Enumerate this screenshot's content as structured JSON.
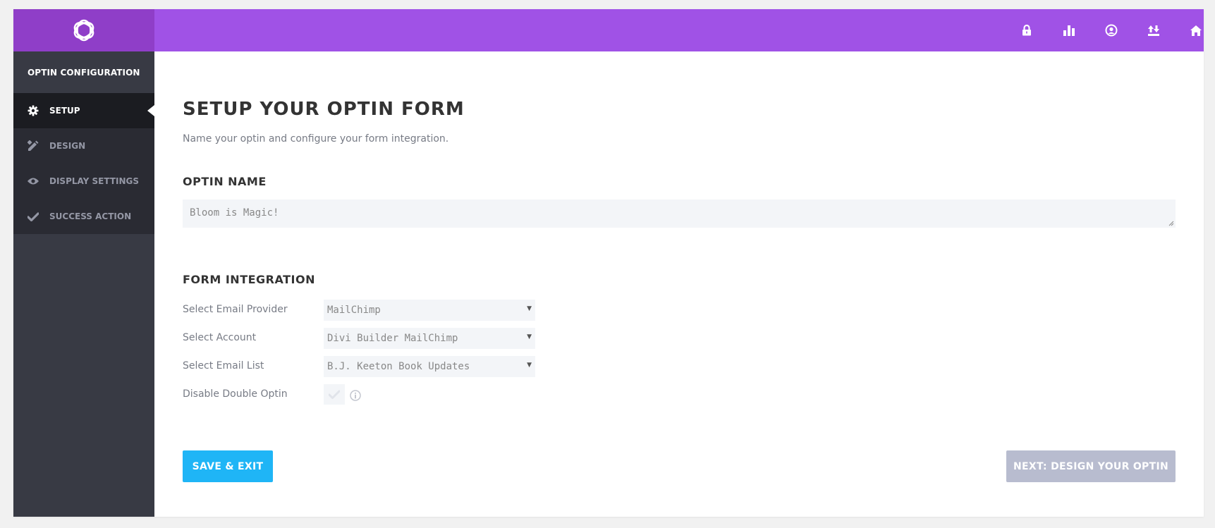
{
  "sidebar": {
    "header": "OPTIN CONFIGURATION",
    "items": [
      {
        "label": "SETUP",
        "icon": "gear-icon",
        "active": true
      },
      {
        "label": "DESIGN",
        "icon": "pencil-ruler-icon",
        "active": false
      },
      {
        "label": "DISPLAY SETTINGS",
        "icon": "eye-icon",
        "active": false
      },
      {
        "label": "SUCCESS ACTION",
        "icon": "checkmark-icon",
        "active": false
      }
    ]
  },
  "topbar": {
    "icons": [
      "lock-icon",
      "bar-chart-icon",
      "user-circle-icon",
      "import-export-icon",
      "home-icon"
    ]
  },
  "main": {
    "title": "SETUP YOUR OPTIN FORM",
    "subtitle": "Name your optin and configure your form integration.",
    "optin_name": {
      "heading": "OPTIN NAME",
      "value": "Bloom is Magic!"
    },
    "form_integration": {
      "heading": "FORM INTEGRATION",
      "email_provider": {
        "label": "Select Email Provider",
        "value": "MailChimp"
      },
      "account": {
        "label": "Select Account",
        "value": "Divi Builder MailChimp"
      },
      "email_list": {
        "label": "Select Email List",
        "value": "B.J. Keeton Book Updates"
      },
      "double_optin": {
        "label": "Disable Double Optin",
        "checked": false
      }
    },
    "buttons": {
      "save": "SAVE & EXIT",
      "next": "NEXT: DESIGN YOUR OPTIN"
    }
  },
  "colors": {
    "topbar": "#a052e6",
    "logo_bg": "#8f3ec8",
    "sidebar": "#383a44",
    "save_button": "#1fb5f6",
    "next_button": "#b8bccf"
  }
}
